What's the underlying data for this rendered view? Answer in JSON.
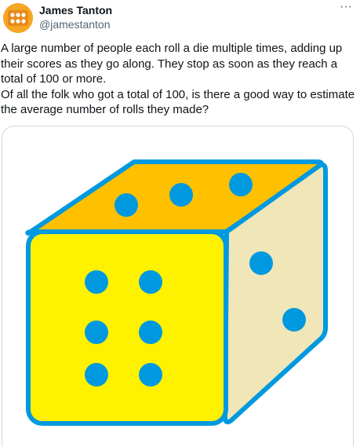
{
  "author": {
    "name": "James Tanton",
    "handle": "@jamestanton",
    "avatar_icon": "avatar-icon"
  },
  "more_icon": "more-options-icon",
  "tweet": {
    "paragraphs": [
      "A large number of people each roll a die multiple times, adding up their scores as they go along. They stop as soon as they reach a total of 100 or more.",
      "Of all the folk who got a total of 100, is there a good way to estimate the average number of rolls they made?"
    ]
  },
  "media": {
    "description_icon": "dice-illustration",
    "colors": {
      "top_face": "#ffc000",
      "front_face": "#fff200",
      "side_face": "#f0e6b8",
      "outline": "#0099e0",
      "pips": "#0099e0"
    },
    "faces": {
      "front_pips": 6,
      "top_pips": 3,
      "side_pips": 2
    }
  }
}
